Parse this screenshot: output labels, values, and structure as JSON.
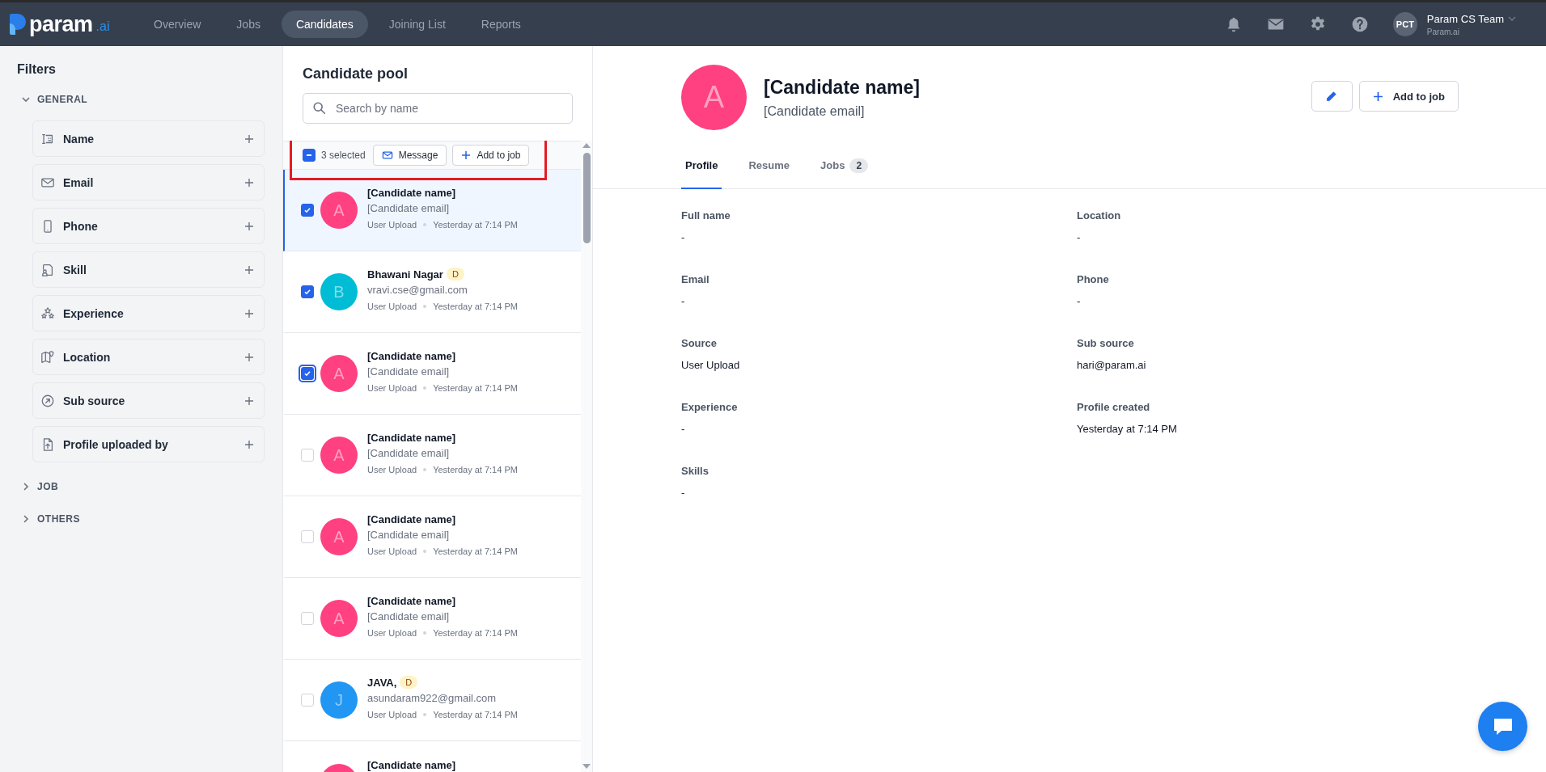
{
  "nav": {
    "logo": {
      "name": "param",
      "suffix": ".ai"
    },
    "items": [
      {
        "label": "Overview",
        "selected": false
      },
      {
        "label": "Jobs",
        "selected": false
      },
      {
        "label": "Candidates",
        "selected": true
      },
      {
        "label": "Joining List",
        "selected": false
      },
      {
        "label": "Reports",
        "selected": false
      }
    ],
    "user": {
      "initials": "PCT",
      "name": "Param CS Team",
      "org": "Param.ai"
    }
  },
  "filters": {
    "title": "Filters",
    "groups": [
      {
        "label": "GENERAL",
        "expanded": true,
        "items": [
          {
            "label": "Name",
            "kind": "name"
          },
          {
            "label": "Email",
            "kind": "email"
          },
          {
            "label": "Phone",
            "kind": "phone"
          },
          {
            "label": "Skill",
            "kind": "skill"
          },
          {
            "label": "Experience",
            "kind": "experience"
          },
          {
            "label": "Location",
            "kind": "location"
          },
          {
            "label": "Sub source",
            "kind": "subsource"
          },
          {
            "label": "Profile uploaded by",
            "kind": "uploader"
          }
        ]
      },
      {
        "label": "JOB",
        "expanded": false
      },
      {
        "label": "OTHERS",
        "expanded": false
      }
    ]
  },
  "pool": {
    "title": "Candidate pool",
    "search": {
      "placeholder": "Search by name"
    },
    "bulk": {
      "indeterminate": true,
      "count": "3 selected",
      "highlighted": true,
      "actions": [
        {
          "label": "Message",
          "kind": "message"
        },
        {
          "label": "Add to job",
          "kind": "add"
        }
      ]
    },
    "candidates": [
      {
        "initial": "A",
        "color": "#ff4081",
        "name": "[Candidate name]",
        "email": "[Candidate email]",
        "source": "User Upload",
        "time": "Yesterday at 7:14 PM",
        "checked": true,
        "selected": true,
        "focused": false
      },
      {
        "initial": "B",
        "color": "#00bcd4",
        "name": "Bhawani Nagar",
        "badge": "D",
        "email": "vravi.cse@gmail.com",
        "source": "User Upload",
        "time": "Yesterday at 7:14 PM",
        "checked": true,
        "selected": false,
        "focused": false
      },
      {
        "initial": "A",
        "color": "#ff4081",
        "name": "[Candidate name]",
        "email": "[Candidate email]",
        "source": "User Upload",
        "time": "Yesterday at 7:14 PM",
        "checked": true,
        "selected": false,
        "focused": true
      },
      {
        "initial": "A",
        "color": "#ff4081",
        "name": "[Candidate name]",
        "email": "[Candidate email]",
        "source": "User Upload",
        "time": "Yesterday at 7:14 PM",
        "checked": false,
        "selected": false,
        "focused": false
      },
      {
        "initial": "A",
        "color": "#ff4081",
        "name": "[Candidate name]",
        "email": "[Candidate email]",
        "source": "User Upload",
        "time": "Yesterday at 7:14 PM",
        "checked": false,
        "selected": false,
        "focused": false
      },
      {
        "initial": "A",
        "color": "#ff4081",
        "name": "[Candidate name]",
        "email": "[Candidate email]",
        "source": "User Upload",
        "time": "Yesterday at 7:14 PM",
        "checked": false,
        "selected": false,
        "focused": false
      },
      {
        "initial": "J",
        "color": "#2196f3",
        "name": "JAVA,",
        "badge": "D",
        "email": "asundaram922@gmail.com",
        "source": "User Upload",
        "time": "Yesterday at 7:14 PM",
        "checked": false,
        "selected": false,
        "focused": false
      },
      {
        "color": "#ff4081",
        "name": "[Candidate name]"
      }
    ]
  },
  "detail": {
    "initial": "A",
    "color": "#ff4081",
    "name": "[Candidate name]",
    "email": "[Candidate email]",
    "actions": [
      {
        "kind": "edit"
      },
      {
        "kind": "add",
        "label": "Add to job"
      }
    ],
    "tabs": [
      {
        "label": "Profile",
        "selected": true
      },
      {
        "label": "Resume",
        "selected": false
      },
      {
        "label": "Jobs",
        "count": "2",
        "selected": false
      }
    ],
    "fields": [
      {
        "label": "Full name",
        "value": "-"
      },
      {
        "label": "Location",
        "value": "-"
      },
      {
        "label": "Email",
        "value": "-"
      },
      {
        "label": "Phone",
        "value": "-"
      },
      {
        "label": "Source",
        "value": "User Upload"
      },
      {
        "label": "Sub source",
        "value": "hari@param.ai"
      },
      {
        "label": "Experience",
        "value": "-"
      },
      {
        "label": "Profile created",
        "value": "Yesterday at 7:14 PM"
      },
      {
        "label": "Skills",
        "value": "-"
      }
    ]
  }
}
